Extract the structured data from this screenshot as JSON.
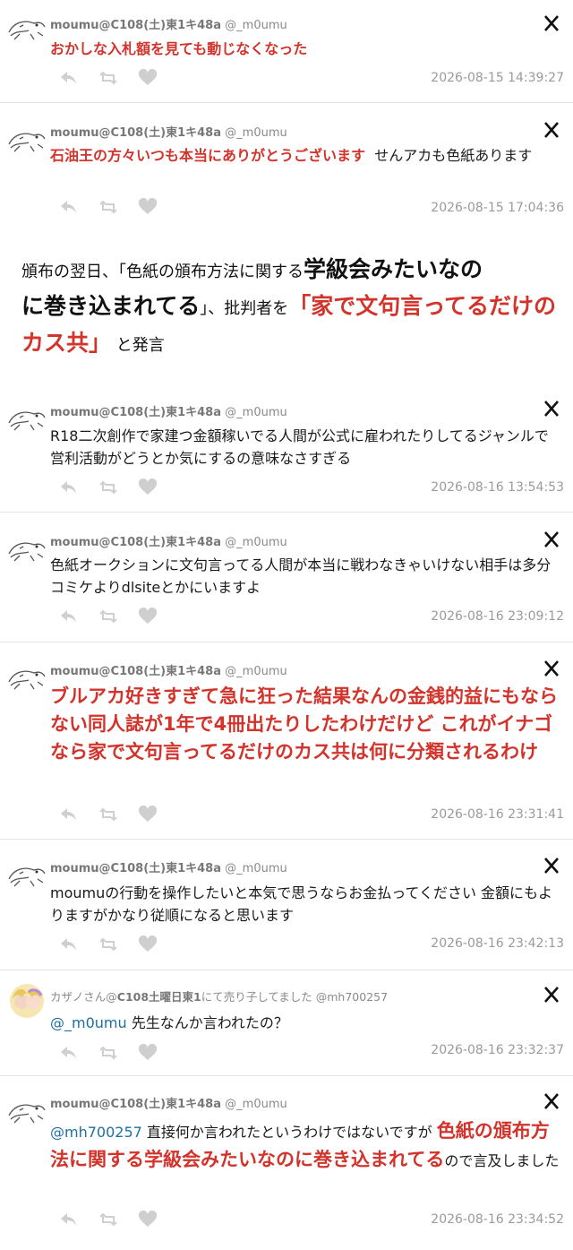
{
  "brand_color": "#d2332b",
  "mention_color": "#1d6fa5",
  "icons": {
    "reply": "reply-icon",
    "retweet": "retweet-icon",
    "like": "like-icon",
    "platform": "x-logo-icon"
  },
  "author": {
    "name": "moumu@C108(土)東1キ48a",
    "handle": "@_m0umu"
  },
  "author2": {
    "name_prefix": "カザノさん@",
    "name_bold": "C108土曜日東1",
    "name_suffix": "にて売り子してました",
    "handle": "@mh700257"
  },
  "posts": [
    {
      "red": "おかしな入札額を見ても動じなくなった",
      "timestamp": "2026-08-15 14:39:27"
    },
    {
      "red": "石油王の方々いつも本当にありがとうございます",
      "text": "せんアカも色紙あります",
      "timestamp": "2026-08-15 17:04:36"
    },
    {
      "text": "R18二次創作で家建つ金額稼いでる人間が公式に雇われたりしてるジャンルで営利活動がどうとか気にするの意味なさすぎる",
      "timestamp": "2026-08-16 13:54:53"
    },
    {
      "text": "色紙オークションに文句言ってる人間が本当に戦わなきゃいけない相手は多分コミケよりdlsiteとかにいますよ",
      "timestamp": "2026-08-16 23:09:12"
    },
    {
      "red": "ブルアカ好きすぎて急に狂った結果なんの金銭的益にもならない同人誌が1年で4冊出たりしたわけだけど これがイナゴなら家で文句言ってるだけのカス共は何に分類されるわけ",
      "timestamp": "2026-08-16 23:31:41"
    },
    {
      "text": "moumuの行動を操作したいと本気で思うならお金払ってください 金額にもよりますがかなり従順になると思います",
      "timestamp": "2026-08-16 23:42:13"
    },
    {
      "mention": "@_m0umu",
      "text": "先生なんか言われたの？",
      "timestamp": "2026-08-16 23:32:37"
    },
    {
      "mention": "@mh700257",
      "text": "直接何か言われたというわけではないですが",
      "red": "色紙の頒布方法に関する学級会みたいなのに巻き込まれて",
      "red2": "る",
      "tail": "ので言及しました",
      "timestamp": "2026-08-16 23:34:52"
    }
  ],
  "caption": {
    "part1": "頒布の翌日、「色紙の頒布方法に関する",
    "part2": "学級会みたいなの",
    "part3": "に巻き込まれてる",
    "part4": "」、批判者を",
    "part5": "「家で文句言ってるだけのカス共」",
    "part6": "と発言"
  }
}
